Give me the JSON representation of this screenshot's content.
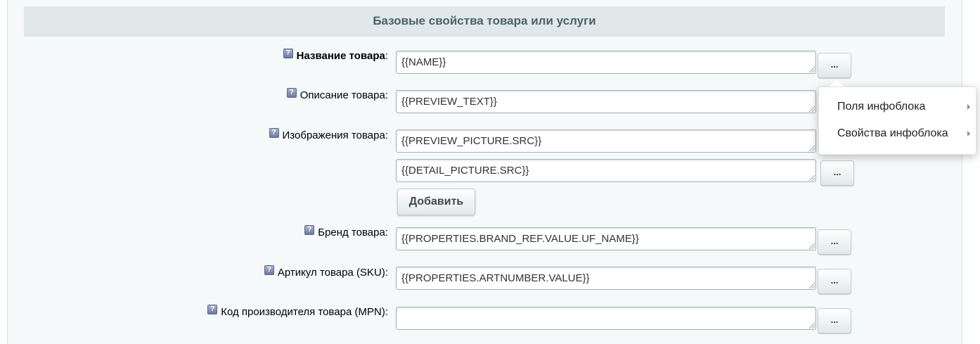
{
  "section": {
    "title": "Базовые свойства товара или услуги"
  },
  "rows": [
    {
      "label": "Название товара",
      "suffix": ":",
      "value": "{{NAME}}"
    },
    {
      "label": "Описание товара:",
      "value": "{{PREVIEW_TEXT}}"
    },
    {
      "label": "Изображения товара:",
      "values": [
        "{{PREVIEW_PICTURE.SRC}}",
        "{{DETAIL_PICTURE.SRC}}"
      ]
    },
    {
      "label": "Бренд товара:",
      "value": "{{PROPERTIES.BRAND_REF.VALUE.UF_NAME}}"
    },
    {
      "label": "Артикул товара (SKU):",
      "value": "{{PROPERTIES.ARTNUMBER.VALUE}}"
    },
    {
      "label": "Код производителя товара (MPN):",
      "value": ""
    }
  ],
  "buttons": {
    "dots_label": "...",
    "add_label": "Добавить"
  },
  "help_icon_glyph": "?",
  "popup": {
    "items": [
      "Поля инфоблока",
      "Свойства инфоблока"
    ]
  }
}
